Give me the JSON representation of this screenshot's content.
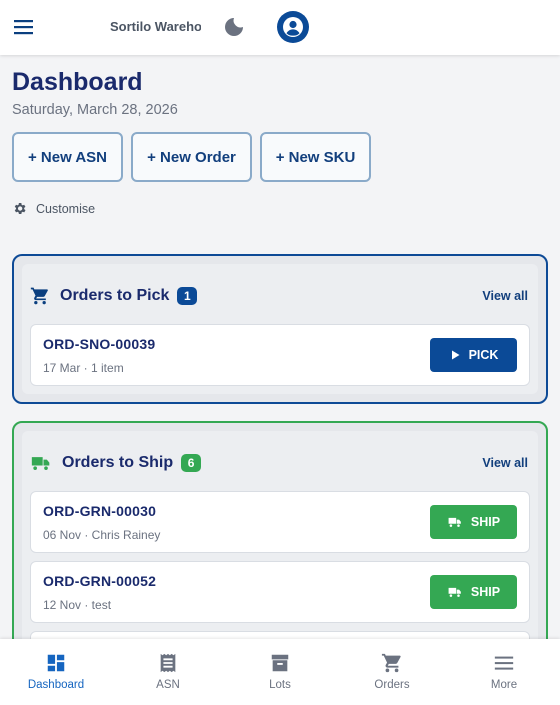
{
  "header": {
    "brand": "Sortilo Warehou"
  },
  "page": {
    "title": "Dashboard",
    "date": "Saturday, March 28, 2026"
  },
  "quick_actions": [
    {
      "label": "+ New ASN"
    },
    {
      "label": "+ New Order"
    },
    {
      "label": "+ New SKU"
    }
  ],
  "customise_label": "Customise",
  "pick_card": {
    "title": "Orders to Pick",
    "count": "1",
    "view_all": "View all",
    "accent": "#0d4a96",
    "orders": [
      {
        "id": "ORD-SNO-00039",
        "meta": "17 Mar · 1 item",
        "action": "PICK"
      }
    ]
  },
  "ship_card": {
    "title": "Orders to Ship",
    "count": "6",
    "view_all": "View all",
    "accent": "#34a853",
    "orders": [
      {
        "id": "ORD-GRN-00030",
        "meta": "06 Nov · Chris Rainey",
        "action": "SHIP"
      },
      {
        "id": "ORD-GRN-00052",
        "meta": "12 Nov · test",
        "action": "SHIP"
      }
    ]
  },
  "bottom_nav": [
    {
      "label": "Dashboard",
      "icon": "dashboard-icon",
      "active": true
    },
    {
      "label": "ASN",
      "icon": "receipt-icon",
      "active": false
    },
    {
      "label": "Lots",
      "icon": "archive-box-icon",
      "active": false
    },
    {
      "label": "Orders",
      "icon": "cart-icon",
      "active": false
    },
    {
      "label": "More",
      "icon": "hamburger-icon",
      "active": false
    }
  ],
  "colors": {
    "primary": "#0b4a97",
    "success": "#34a853",
    "title": "#1a2a6c",
    "nav_active": "#1565c0"
  }
}
